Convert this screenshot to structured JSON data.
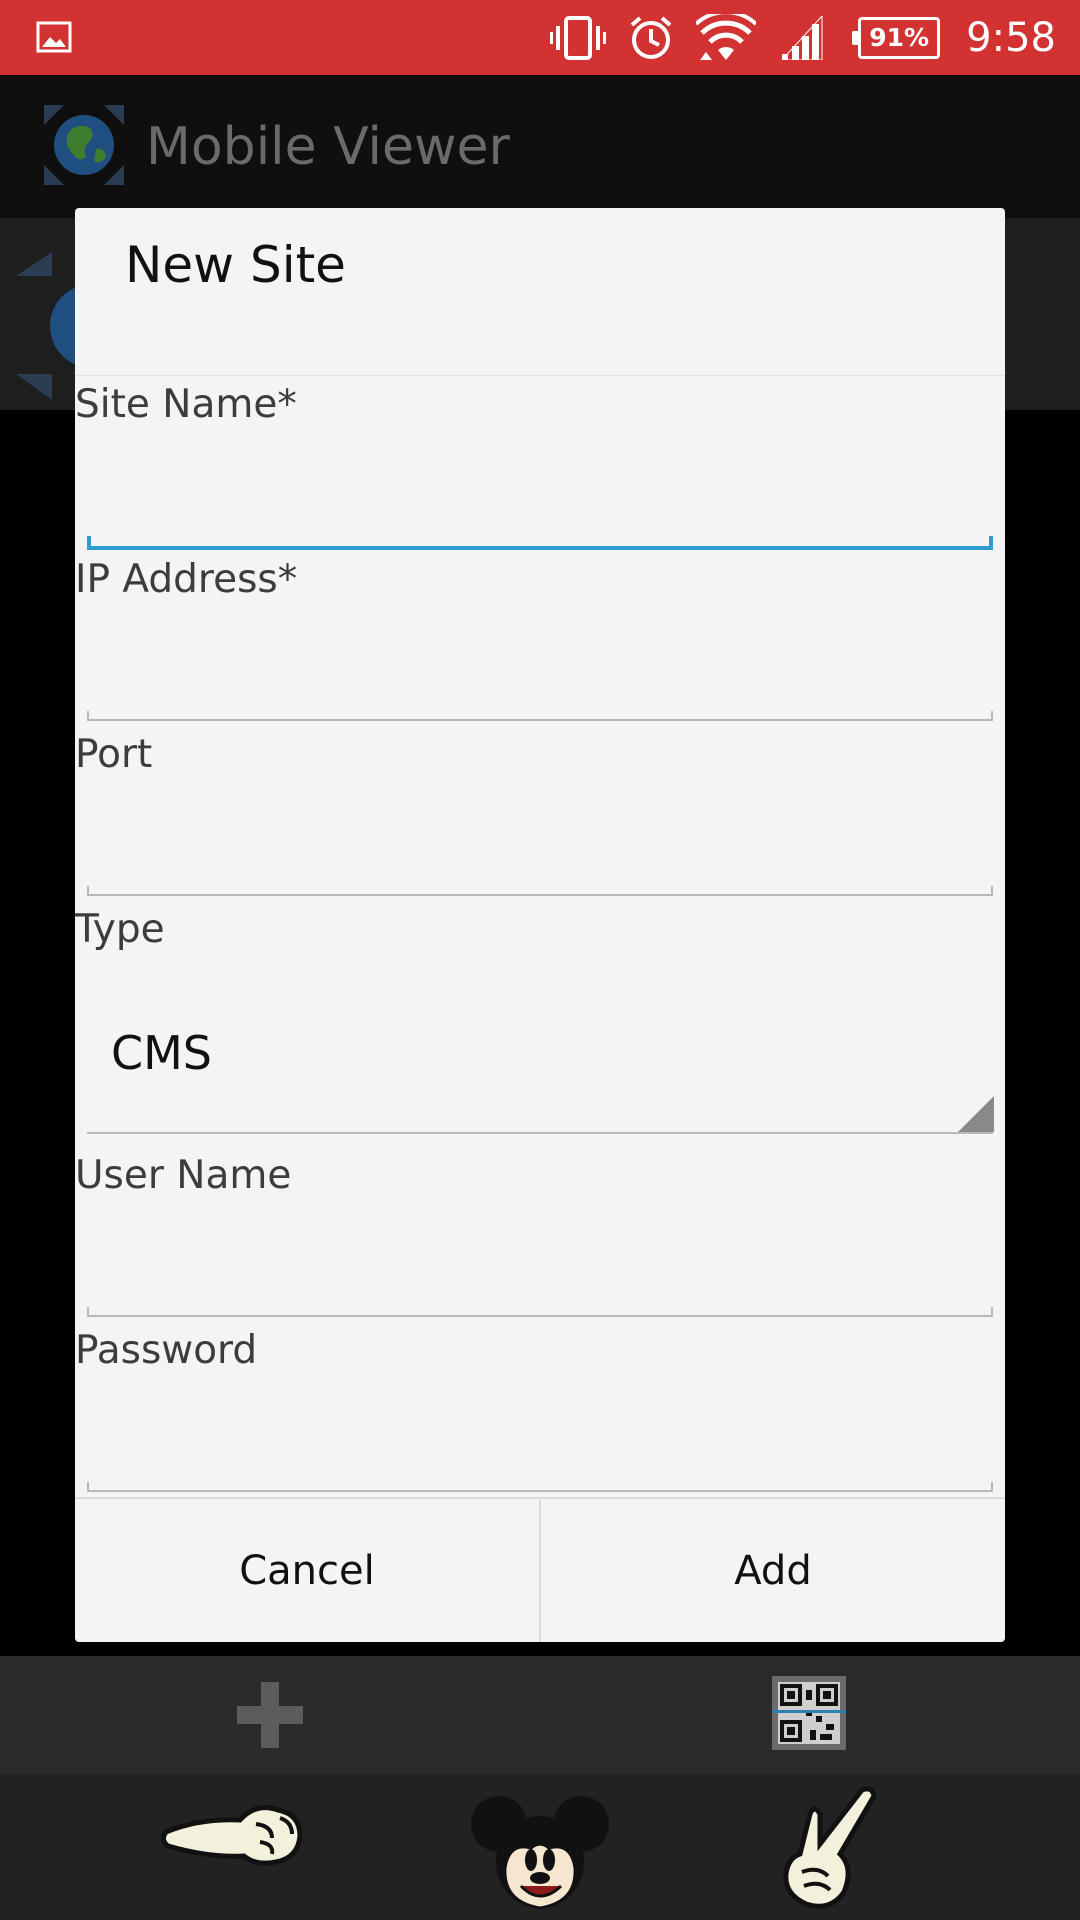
{
  "status_bar": {
    "battery": "91%",
    "time": "9:58",
    "icons": [
      "gallery-icon",
      "vibrate-icon",
      "alarm-icon",
      "wifi-icon",
      "signal-icon",
      "battery-icon"
    ],
    "background_color": "#d23232"
  },
  "app": {
    "title": "Mobile Viewer"
  },
  "dialog": {
    "title": "New Site",
    "fields": [
      {
        "label": "Site Name*",
        "value": ""
      },
      {
        "label": "IP Address*",
        "value": ""
      },
      {
        "label": "Port",
        "value": ""
      },
      {
        "label": "User Name",
        "value": ""
      },
      {
        "label": "Password",
        "value": ""
      }
    ],
    "type_field": {
      "label": "Type",
      "selected": "CMS"
    },
    "buttons": {
      "cancel": "Cancel",
      "add": "Add"
    },
    "focus_color": "#2e9dcf"
  },
  "bottom_toolbar": {
    "icons": [
      "add-icon",
      "qr-code-icon"
    ]
  },
  "nav_bar": {
    "icons": [
      "back-pointing-hand-icon",
      "mickey-home-icon",
      "peace-hand-recent-icon"
    ]
  }
}
